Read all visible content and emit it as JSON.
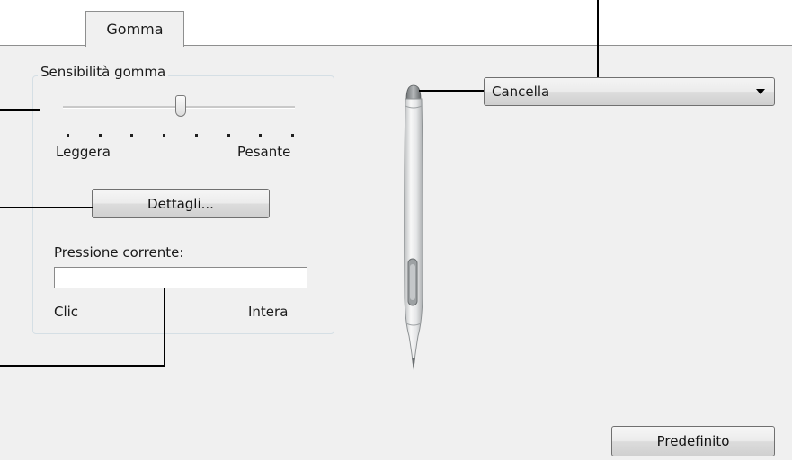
{
  "tab": {
    "label": "Gomma"
  },
  "eraser_group": {
    "title": "Sensibilità gomma",
    "slider": {
      "value_fraction": 0.5,
      "tick_count": 8
    },
    "min_label": "Leggera",
    "max_label": "Pesante",
    "details_button": "Dettagli...",
    "pressure_title": "Pressione corrente:",
    "pressure_value": 0,
    "pressure_min_label": "Clic",
    "pressure_max_label": "Intera"
  },
  "eraser_function": {
    "selected": "Cancella"
  },
  "default_button": "Predefinito",
  "colors": {
    "panel_background": "#f0f0f0",
    "border": "#8e8f8f",
    "callout_line": "#000000"
  },
  "icons": {
    "pen": "pen-stylus-icon",
    "dropdown_arrow": "chevron-down-icon"
  }
}
